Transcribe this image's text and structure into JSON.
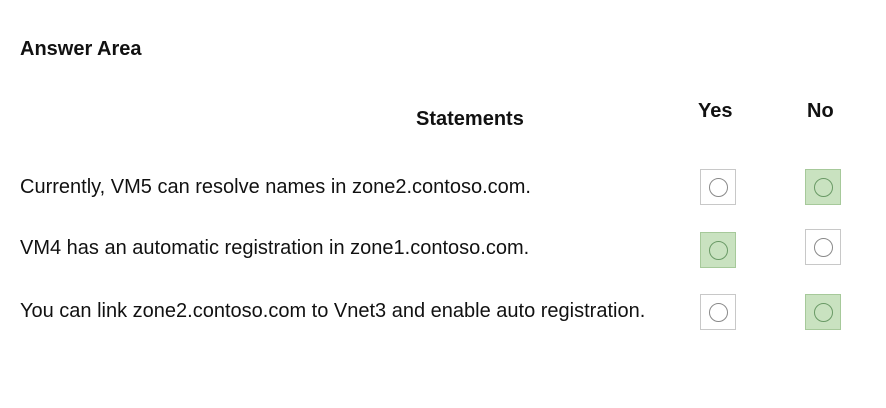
{
  "title": "Answer Area",
  "columns": {
    "statements": "Statements",
    "yes": "Yes",
    "no": "No"
  },
  "rows": [
    {
      "statement": "Currently, VM5 can resolve names in zone2.contoso.com.",
      "selected": "No"
    },
    {
      "statement": "VM4 has an automatic registration in zone1.contoso.com.",
      "selected": "Yes"
    },
    {
      "statement": "You can link zone2.contoso.com to Vnet3 and enable auto registration.",
      "selected": "No"
    }
  ],
  "colors": {
    "selected_fill": "#c9e2c0",
    "selected_border": "#a6c99a",
    "unselected_border": "#c8c8c8"
  },
  "icons": {
    "option": "radio-circle-icon"
  }
}
